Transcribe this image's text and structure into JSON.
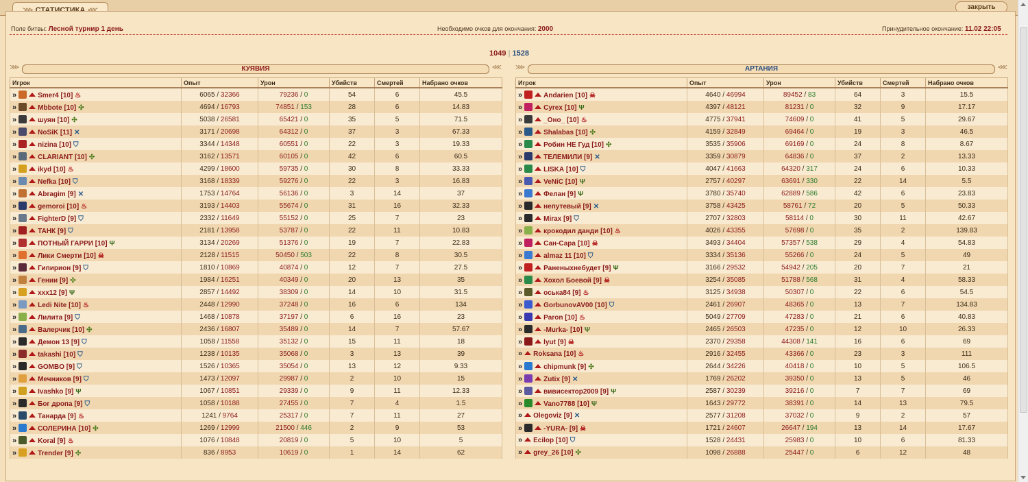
{
  "header": {
    "tab_title": "СТАТИСТИКА",
    "close_label": "закрыть"
  },
  "info": {
    "field_label": "Поле битвы:",
    "field_value": "Лесной турнир 1 день",
    "points_label": "Необходимо очков для окончания:",
    "points_value": "2000",
    "forced_label": "Принудительное окончание:",
    "forced_value": "11.02 22:05"
  },
  "score": {
    "left": "1049",
    "separator": "|",
    "right": "1528"
  },
  "columns": [
    "Игрок",
    "Опыт",
    "Урон",
    "Убийств",
    "Смертей",
    "Набрано очков"
  ],
  "colors": {
    "accent_red": "#8b1a1a",
    "accent_blue": "#2b4f80",
    "green": "#2a7a2a"
  },
  "teams": [
    {
      "name": "КУЯВИЯ",
      "color": "#8b1a1a",
      "players": [
        {
          "name": "Smer4",
          "lvl": "[10]",
          "icon": "flame-icon",
          "av": "#c96a2a",
          "exp": "6065",
          "expmax": "32366",
          "dmg": "79236",
          "dmg2": "0",
          "kills": "54",
          "deaths": "6",
          "pts": "45.5"
        },
        {
          "name": "Mbbote",
          "lvl": "[10]",
          "icon": "cross-icon",
          "av": "#6b4a2a",
          "exp": "4694",
          "expmax": "16793",
          "dmg": "74851",
          "dmg2": "153",
          "kills": "28",
          "deaths": "6",
          "pts": "14.83"
        },
        {
          "name": "шуян",
          "lvl": "[10]",
          "icon": "cross-icon",
          "av": "#3a3a3a",
          "exp": "5038",
          "expmax": "26581",
          "dmg": "65421",
          "dmg2": "0",
          "kills": "35",
          "deaths": "5",
          "pts": "71.5"
        },
        {
          "name": "NoSiK",
          "lvl": "[11]",
          "icon": "swords-icon",
          "av": "#4a4a6a",
          "exp": "3171",
          "expmax": "20698",
          "dmg": "64312",
          "dmg2": "0",
          "kills": "37",
          "deaths": "3",
          "pts": "67.33"
        },
        {
          "name": "nizina",
          "lvl": "[10]",
          "icon": "shield-icon",
          "av": "#a22",
          "exp": "3344",
          "expmax": "14348",
          "dmg": "60551",
          "dmg2": "0",
          "kills": "22",
          "deaths": "3",
          "pts": "19.33"
        },
        {
          "name": "CLARIANT",
          "lvl": "[10]",
          "icon": "cross-icon",
          "av": "#5a6a7a",
          "exp": "3162",
          "expmax": "13571",
          "dmg": "60105",
          "dmg2": "0",
          "kills": "42",
          "deaths": "6",
          "pts": "60.5"
        },
        {
          "name": "ikyd",
          "lvl": "[10]",
          "icon": "flame-icon",
          "av": "#d4a020",
          "exp": "4299",
          "expmax": "18600",
          "dmg": "59735",
          "dmg2": "0",
          "kills": "30",
          "deaths": "8",
          "pts": "33.33"
        },
        {
          "name": "Nefka",
          "lvl": "[10]",
          "icon": "shield-icon",
          "av": "#6a8ab0",
          "exp": "3168",
          "expmax": "18339",
          "dmg": "59276",
          "dmg2": "0",
          "kills": "22",
          "deaths": "3",
          "pts": "16.83"
        },
        {
          "name": "Abragim",
          "lvl": "[9]",
          "icon": "swords-icon",
          "av": "#c07030",
          "exp": "1753",
          "expmax": "14764",
          "dmg": "56136",
          "dmg2": "0",
          "kills": "3",
          "deaths": "14",
          "pts": "37"
        },
        {
          "name": "gemoroi",
          "lvl": "[10]",
          "icon": "flame-icon",
          "av": "#2a3a6a",
          "exp": "3193",
          "expmax": "14403",
          "dmg": "55674",
          "dmg2": "0",
          "kills": "31",
          "deaths": "16",
          "pts": "32.33"
        },
        {
          "name": "FighterD",
          "lvl": "[9]",
          "icon": "shield-icon",
          "av": "#6a7a8a",
          "exp": "2332",
          "expmax": "11649",
          "dmg": "55152",
          "dmg2": "0",
          "kills": "25",
          "deaths": "7",
          "pts": "23"
        },
        {
          "name": "ТАНК",
          "lvl": "[9]",
          "icon": "shield-icon",
          "av": "#a02020",
          "exp": "2181",
          "expmax": "13958",
          "dmg": "53787",
          "dmg2": "0",
          "kills": "22",
          "deaths": "11",
          "pts": "10.83"
        },
        {
          "name": "ПОТНЫЙ ГАРРИ",
          "lvl": "[10]",
          "icon": "trident-icon",
          "av": "#b03030",
          "exp": "3134",
          "expmax": "20269",
          "dmg": "51376",
          "dmg2": "0",
          "kills": "19",
          "deaths": "7",
          "pts": "22.83"
        },
        {
          "name": "Лики Смерти",
          "lvl": "[10]",
          "icon": "skull-icon",
          "av": "#e07030",
          "exp": "2128",
          "expmax": "11515",
          "dmg": "50450",
          "dmg2": "503",
          "kills": "22",
          "deaths": "8",
          "pts": "30.5"
        },
        {
          "name": "Гипирион",
          "lvl": "[9]",
          "icon": "shield-icon",
          "av": "#5a2a3a",
          "exp": "1810",
          "expmax": "10869",
          "dmg": "40874",
          "dmg2": "0",
          "kills": "12",
          "deaths": "7",
          "pts": "27.5"
        },
        {
          "name": "Гении",
          "lvl": "[9]",
          "icon": "cross-icon",
          "av": "#c08040",
          "exp": "1984",
          "expmax": "16251",
          "dmg": "40349",
          "dmg2": "0",
          "kills": "20",
          "deaths": "13",
          "pts": "35"
        },
        {
          "name": "xxx12",
          "lvl": "[9]",
          "icon": "trident-icon",
          "av": "#d8a020",
          "exp": "2857",
          "expmax": "14492",
          "dmg": "38309",
          "dmg2": "0",
          "kills": "14",
          "deaths": "10",
          "pts": "31.5"
        },
        {
          "name": "Ledi Nite",
          "lvl": "[10]",
          "icon": "flame-icon",
          "av": "#7a9ac0",
          "exp": "2448",
          "expmax": "12990",
          "dmg": "37248",
          "dmg2": "0",
          "kills": "16",
          "deaths": "6",
          "pts": "134"
        },
        {
          "name": "Лилита",
          "lvl": "[9]",
          "icon": "shield-icon",
          "av": "#8ab04a",
          "exp": "1468",
          "expmax": "10878",
          "dmg": "37197",
          "dmg2": "0",
          "kills": "6",
          "deaths": "16",
          "pts": "23"
        },
        {
          "name": "Валерчик",
          "lvl": "[10]",
          "icon": "cross-icon",
          "av": "#4a6a8a",
          "exp": "2436",
          "expmax": "16807",
          "dmg": "35489",
          "dmg2": "0",
          "kills": "14",
          "deaths": "7",
          "pts": "57.67"
        },
        {
          "name": "Демон 13",
          "lvl": "[9]",
          "icon": "shield-icon",
          "av": "#2a2a2a",
          "exp": "1058",
          "expmax": "11558",
          "dmg": "35132",
          "dmg2": "0",
          "kills": "15",
          "deaths": "11",
          "pts": "18"
        },
        {
          "name": "takashi",
          "lvl": "[10]",
          "icon": "shield-icon",
          "av": "#8a2a2a",
          "exp": "1238",
          "expmax": "10135",
          "dmg": "35068",
          "dmg2": "0",
          "kills": "3",
          "deaths": "13",
          "pts": "39"
        },
        {
          "name": "GOMBO",
          "lvl": "[9]",
          "icon": "shield-icon",
          "av": "#2a2a2a",
          "exp": "1526",
          "expmax": "10365",
          "dmg": "35054",
          "dmg2": "0",
          "kills": "13",
          "deaths": "12",
          "pts": "9.33"
        },
        {
          "name": "Мечников",
          "lvl": "[9]",
          "icon": "shield-icon",
          "av": "#e0a040",
          "exp": "1473",
          "expmax": "12097",
          "dmg": "29987",
          "dmg2": "0",
          "kills": "2",
          "deaths": "10",
          "pts": "15"
        },
        {
          "name": "Ivashko",
          "lvl": "[9]",
          "icon": "trident-icon",
          "av": "#d0a020",
          "exp": "1067",
          "expmax": "10851",
          "dmg": "29339",
          "dmg2": "0",
          "kills": "9",
          "deaths": "11",
          "pts": "12.33"
        },
        {
          "name": "Бог дропа",
          "lvl": "[9]",
          "icon": "shield-icon",
          "av": "#2a2a2a",
          "exp": "1058",
          "expmax": "10188",
          "dmg": "27455",
          "dmg2": "0",
          "kills": "7",
          "deaths": "4",
          "pts": "1.5"
        },
        {
          "name": "Танарда",
          "lvl": "[9]",
          "icon": "flame-icon",
          "av": "#2a4a6a",
          "exp": "1241",
          "expmax": "9764",
          "dmg": "25317",
          "dmg2": "0",
          "kills": "7",
          "deaths": "11",
          "pts": "27"
        },
        {
          "name": "СОЛЕРИНА",
          "lvl": "[10]",
          "icon": "cross-icon",
          "av": "#2a7ad0",
          "exp": "1269",
          "expmax": "12999",
          "dmg": "21500",
          "dmg2": "446",
          "kills": "2",
          "deaths": "9",
          "pts": "53"
        },
        {
          "name": "Koral",
          "lvl": "[9]",
          "icon": "flame-icon",
          "av": "#4a5a2a",
          "exp": "1076",
          "expmax": "10848",
          "dmg": "20819",
          "dmg2": "0",
          "kills": "5",
          "deaths": "10",
          "pts": "5"
        },
        {
          "name": "Trender",
          "lvl": "[9]",
          "icon": "cross-icon",
          "av": "#d8a020",
          "exp": "836",
          "expmax": "8953",
          "dmg": "10619",
          "dmg2": "0",
          "kills": "1",
          "deaths": "14",
          "pts": "62"
        }
      ]
    },
    {
      "name": "АРТАНИЯ",
      "color": "#2b4f80",
      "players": [
        {
          "name": "Andarien",
          "lvl": "[10]",
          "icon": "skull-icon",
          "av": "#c02020",
          "exp": "4640",
          "expmax": "46994",
          "dmg": "89452",
          "dmg2": "83",
          "kills": "64",
          "deaths": "3",
          "pts": "15.5"
        },
        {
          "name": "Cyrex",
          "lvl": "[10]",
          "icon": "trident-icon",
          "av": "#c02060",
          "exp": "4397",
          "expmax": "48121",
          "dmg": "81231",
          "dmg2": "0",
          "kills": "32",
          "deaths": "9",
          "pts": "17.17"
        },
        {
          "name": "_Оно_",
          "lvl": "[10]",
          "icon": "flame-icon",
          "av": "#3a3a3a",
          "exp": "4775",
          "expmax": "37941",
          "dmg": "74609",
          "dmg2": "0",
          "kills": "41",
          "deaths": "5",
          "pts": "29.67"
        },
        {
          "name": "Shalabas",
          "lvl": "[10]",
          "icon": "cross-icon",
          "av": "#2a5a8a",
          "exp": "4159",
          "expmax": "32849",
          "dmg": "69464",
          "dmg2": "0",
          "kills": "19",
          "deaths": "3",
          "pts": "46.5"
        },
        {
          "name": "Робин НЕ Гуд",
          "lvl": "[10]",
          "icon": "cross-icon",
          "av": "#2a8a4a",
          "exp": "3535",
          "expmax": "35906",
          "dmg": "69169",
          "dmg2": "0",
          "kills": "24",
          "deaths": "8",
          "pts": "8.67"
        },
        {
          "name": "ТЕЛЕМИЛИ",
          "lvl": "[9]",
          "icon": "swords-icon",
          "av": "#2a3a6a",
          "exp": "3359",
          "expmax": "30879",
          "dmg": "64836",
          "dmg2": "0",
          "kills": "37",
          "deaths": "2",
          "pts": "13.33"
        },
        {
          "name": "LISKA",
          "lvl": "[10]",
          "icon": "shield-icon",
          "av": "#2a8a4a",
          "exp": "4047",
          "expmax": "41663",
          "dmg": "64320",
          "dmg2": "317",
          "kills": "24",
          "deaths": "6",
          "pts": "10.33"
        },
        {
          "name": "VeNiC",
          "lvl": "[10]",
          "icon": "trident-icon",
          "av": "#4a5ab0",
          "exp": "2757",
          "expmax": "40297",
          "dmg": "63691",
          "dmg2": "330",
          "kills": "22",
          "deaths": "14",
          "pts": "5.5"
        },
        {
          "name": "Фелан",
          "lvl": "[9]",
          "icon": "trident-icon",
          "av": "#3a7ad0",
          "exp": "3780",
          "expmax": "35740",
          "dmg": "62889",
          "dmg2": "586",
          "kills": "42",
          "deaths": "6",
          "pts": "23.83"
        },
        {
          "name": "непутевый",
          "lvl": "[9]",
          "icon": "swords-icon",
          "av": "#2a2a2a",
          "exp": "3758",
          "expmax": "43425",
          "dmg": "58761",
          "dmg2": "72",
          "kills": "20",
          "deaths": "5",
          "pts": "50.33"
        },
        {
          "name": "Mirax",
          "lvl": "[9]",
          "icon": "shield-icon",
          "av": "#2a2a2a",
          "exp": "2707",
          "expmax": "32803",
          "dmg": "58114",
          "dmg2": "0",
          "kills": "30",
          "deaths": "11",
          "pts": "42.67"
        },
        {
          "name": "крокодил данди",
          "lvl": "[10]",
          "icon": "flame-icon",
          "av": "#8ab04a",
          "exp": "4026",
          "expmax": "43355",
          "dmg": "57698",
          "dmg2": "0",
          "kills": "35",
          "deaths": "2",
          "pts": "139.83"
        },
        {
          "name": "Сан-Сара",
          "lvl": "[10]",
          "icon": "skull-icon",
          "av": "#c02060",
          "exp": "3493",
          "expmax": "34404",
          "dmg": "57357",
          "dmg2": "538",
          "kills": "29",
          "deaths": "4",
          "pts": "54.83"
        },
        {
          "name": "almaz 11",
          "lvl": "[10]",
          "icon": "shield-icon",
          "av": "#3a7ad0",
          "exp": "3334",
          "expmax": "35136",
          "dmg": "55266",
          "dmg2": "0",
          "kills": "24",
          "deaths": "5",
          "pts": "49"
        },
        {
          "name": "Раненыхнебудет",
          "lvl": "[9]",
          "icon": "trident-icon",
          "av": "#c02020",
          "exp": "3166",
          "expmax": "29532",
          "dmg": "54942",
          "dmg2": "205",
          "kills": "20",
          "deaths": "7",
          "pts": "21"
        },
        {
          "name": "Хохол Боевой",
          "lvl": "[9]",
          "icon": "skull-icon",
          "av": "#2a8a4a",
          "exp": "3254",
          "expmax": "35085",
          "dmg": "51788",
          "dmg2": "568",
          "kills": "31",
          "deaths": "4",
          "pts": "58.33"
        },
        {
          "name": "оська84",
          "lvl": "[9]",
          "icon": "flame-icon",
          "av": "#5a5a2a",
          "exp": "3125",
          "expmax": "34938",
          "dmg": "50307",
          "dmg2": "0",
          "kills": "22",
          "deaths": "6",
          "pts": "54.5"
        },
        {
          "name": "GorbunovAV00",
          "lvl": "[10]",
          "icon": "shield-icon",
          "av": "#3a5ad0",
          "exp": "2461",
          "expmax": "26907",
          "dmg": "48365",
          "dmg2": "0",
          "kills": "13",
          "deaths": "7",
          "pts": "134.83"
        },
        {
          "name": "Paron",
          "lvl": "[10]",
          "icon": "flame-icon",
          "av": "#3a3ab0",
          "exp": "5049",
          "expmax": "27709",
          "dmg": "47283",
          "dmg2": "0",
          "kills": "21",
          "deaths": "6",
          "pts": "40.83"
        },
        {
          "name": "-Murka-",
          "lvl": "[10]",
          "icon": "trident-icon",
          "av": "#2a2a2a",
          "exp": "2465",
          "expmax": "26503",
          "dmg": "47235",
          "dmg2": "0",
          "kills": "12",
          "deaths": "10",
          "pts": "26.33"
        },
        {
          "name": "lyut",
          "lvl": "[9]",
          "icon": "skull-icon",
          "av": "#8a1a1a",
          "exp": "2370",
          "expmax": "29358",
          "dmg": "44308",
          "dmg2": "141",
          "kills": "16",
          "deaths": "6",
          "pts": "69"
        },
        {
          "name": "Roksana",
          "lvl": "[10]",
          "icon": "flame-icon",
          "av": "",
          "exp": "2916",
          "expmax": "32455",
          "dmg": "43366",
          "dmg2": "0",
          "kills": "23",
          "deaths": "3",
          "pts": "111"
        },
        {
          "name": "chipmunk",
          "lvl": "[9]",
          "icon": "cross-icon",
          "av": "#2a7ad0",
          "exp": "2644",
          "expmax": "34226",
          "dmg": "40418",
          "dmg2": "0",
          "kills": "10",
          "deaths": "5",
          "pts": "106.5"
        },
        {
          "name": "Zutix",
          "lvl": "[9]",
          "icon": "swords-icon",
          "av": "#7a3ab0",
          "exp": "1769",
          "expmax": "26202",
          "dmg": "39350",
          "dmg2": "0",
          "kills": "13",
          "deaths": "5",
          "pts": "46"
        },
        {
          "name": "вивисектор2009",
          "lvl": "[9]",
          "icon": "trident-icon",
          "av": "#5a5aa0",
          "exp": "2587",
          "expmax": "30239",
          "dmg": "39216",
          "dmg2": "0",
          "kills": "7",
          "deaths": "7",
          "pts": "69"
        },
        {
          "name": "Vano7788",
          "lvl": "[10]",
          "icon": "trident-icon",
          "av": "#2a8a2a",
          "exp": "1643",
          "expmax": "29772",
          "dmg": "38391",
          "dmg2": "0",
          "kills": "14",
          "deaths": "13",
          "pts": "79.5"
        },
        {
          "name": "Olegoviz",
          "lvl": "[9]",
          "icon": "swords-icon",
          "av": "",
          "exp": "2577",
          "expmax": "31208",
          "dmg": "37032",
          "dmg2": "0",
          "kills": "9",
          "deaths": "2",
          "pts": "57"
        },
        {
          "name": "-YURA-",
          "lvl": "[9]",
          "icon": "skull-icon",
          "av": "#2a2a2a",
          "exp": "1721",
          "expmax": "24607",
          "dmg": "26647",
          "dmg2": "194",
          "kills": "13",
          "deaths": "14",
          "pts": "17.67"
        },
        {
          "name": "Ecilop",
          "lvl": "[10]",
          "icon": "shield-icon",
          "av": "",
          "exp": "1528",
          "expmax": "24431",
          "dmg": "25983",
          "dmg2": "0",
          "kills": "10",
          "deaths": "6",
          "pts": "81.33"
        },
        {
          "name": "grey_26",
          "lvl": "[10]",
          "icon": "cross-icon",
          "av": "",
          "exp": "1098",
          "expmax": "26888",
          "dmg": "25447",
          "dmg2": "0",
          "kills": "6",
          "deaths": "12",
          "pts": "48"
        }
      ]
    }
  ]
}
